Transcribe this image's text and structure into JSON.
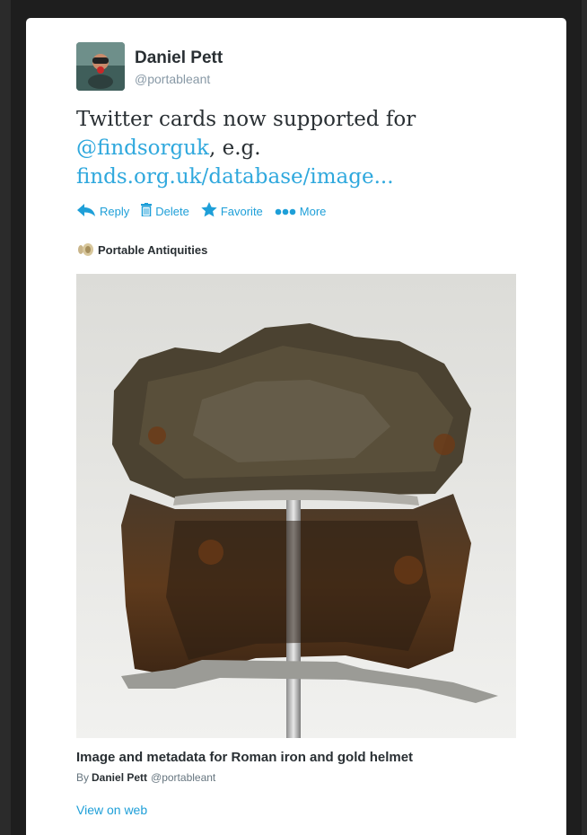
{
  "author": {
    "name": "Daniel Pett",
    "handle": "@portableant"
  },
  "tweet": {
    "text_line1": "Twitter cards now supported for",
    "mention": "@findsorguk",
    "text_after_mention": ", e.g.",
    "link": "finds.org.uk/database/image..."
  },
  "actions": {
    "reply": "Reply",
    "delete": "Delete",
    "favorite": "Favorite",
    "more": "More"
  },
  "card": {
    "source": "Portable Antiquities",
    "title": "Image and metadata for Roman iron and gold helmet",
    "by_prefix": "By",
    "by_name": "Daniel Pett",
    "by_handle": "@portableant",
    "view_on_web": "View on web"
  },
  "colors": {
    "link": "#1e9fd8",
    "text": "#292f33",
    "muted": "#8899a6"
  },
  "icons": {
    "reply": "reply-arrow-icon",
    "delete": "trash-icon",
    "favorite": "star-icon",
    "more": "more-dots-icon"
  }
}
